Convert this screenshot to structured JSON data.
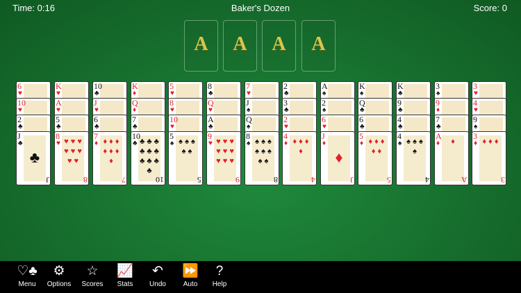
{
  "header": {
    "time": "Time: 0:16",
    "title": "Baker's Dozen",
    "score": "Score: 0"
  },
  "foundations": [
    "A",
    "A",
    "A",
    "A"
  ],
  "tableau": [
    [
      {
        "r": "6",
        "s": "♥"
      },
      {
        "r": "10",
        "s": "♥"
      },
      {
        "r": "2",
        "s": "♣"
      },
      {
        "r": "J",
        "s": "♣"
      }
    ],
    [
      {
        "r": "K",
        "s": "♥"
      },
      {
        "r": "A",
        "s": "♥"
      },
      {
        "r": "5",
        "s": "♣"
      },
      {
        "r": "8",
        "s": "♥"
      }
    ],
    [
      {
        "r": "10",
        "s": "♣"
      },
      {
        "r": "J",
        "s": "♥"
      },
      {
        "r": "6",
        "s": "♣"
      },
      {
        "r": "7",
        "s": "♦"
      }
    ],
    [
      {
        "r": "K",
        "s": "♦"
      },
      {
        "r": "Q",
        "s": "♦"
      },
      {
        "r": "7",
        "s": "♣"
      },
      {
        "r": "10",
        "s": "♣"
      }
    ],
    [
      {
        "r": "5",
        "s": "♥"
      },
      {
        "r": "8",
        "s": "♥"
      },
      {
        "r": "10",
        "s": "♥"
      },
      {
        "r": "5",
        "s": "♠"
      }
    ],
    [
      {
        "r": "8",
        "s": "♣"
      },
      {
        "r": "Q",
        "s": "♥"
      },
      {
        "r": "A",
        "s": "♣"
      },
      {
        "r": "9",
        "s": "♥"
      }
    ],
    [
      {
        "r": "7",
        "s": "♥"
      },
      {
        "r": "J",
        "s": "♠"
      },
      {
        "r": "Q",
        "s": "♠"
      },
      {
        "r": "8",
        "s": "♠"
      }
    ],
    [
      {
        "r": "2",
        "s": "♣"
      },
      {
        "r": "3",
        "s": "♣"
      },
      {
        "r": "2",
        "s": "♥"
      },
      {
        "r": "4",
        "s": "♦"
      }
    ],
    [
      {
        "r": "A",
        "s": "♠"
      },
      {
        "r": "2",
        "s": "♠"
      },
      {
        "r": "6",
        "s": "♥"
      },
      {
        "r": "J",
        "s": "♦"
      }
    ],
    [
      {
        "r": "K",
        "s": "♠"
      },
      {
        "r": "Q",
        "s": "♣"
      },
      {
        "r": "6",
        "s": "♣"
      },
      {
        "r": "5",
        "s": "♦"
      }
    ],
    [
      {
        "r": "K",
        "s": "♣"
      },
      {
        "r": "9",
        "s": "♣"
      },
      {
        "r": "4",
        "s": "♣"
      },
      {
        "r": "4",
        "s": "♠"
      }
    ],
    [
      {
        "r": "3",
        "s": "♠"
      },
      {
        "r": "9",
        "s": "♦"
      },
      {
        "r": "7",
        "s": "♣"
      },
      {
        "r": "A",
        "s": "♦"
      }
    ],
    [
      {
        "r": "3",
        "s": "♥"
      },
      {
        "r": "4",
        "s": "♥"
      },
      {
        "r": "9",
        "s": "♠"
      },
      {
        "r": "3",
        "s": "♦"
      }
    ]
  ],
  "toolbar": [
    {
      "label": "Menu",
      "icon": "♡♣"
    },
    {
      "label": "Options",
      "icon": "⚙"
    },
    {
      "label": "Scores",
      "icon": "☆"
    },
    {
      "label": "Stats",
      "icon": "📈"
    },
    {
      "label": "Undo",
      "icon": "↶"
    },
    {
      "label": "Auto",
      "icon": "⏩"
    },
    {
      "label": "Help",
      "icon": "?"
    }
  ]
}
